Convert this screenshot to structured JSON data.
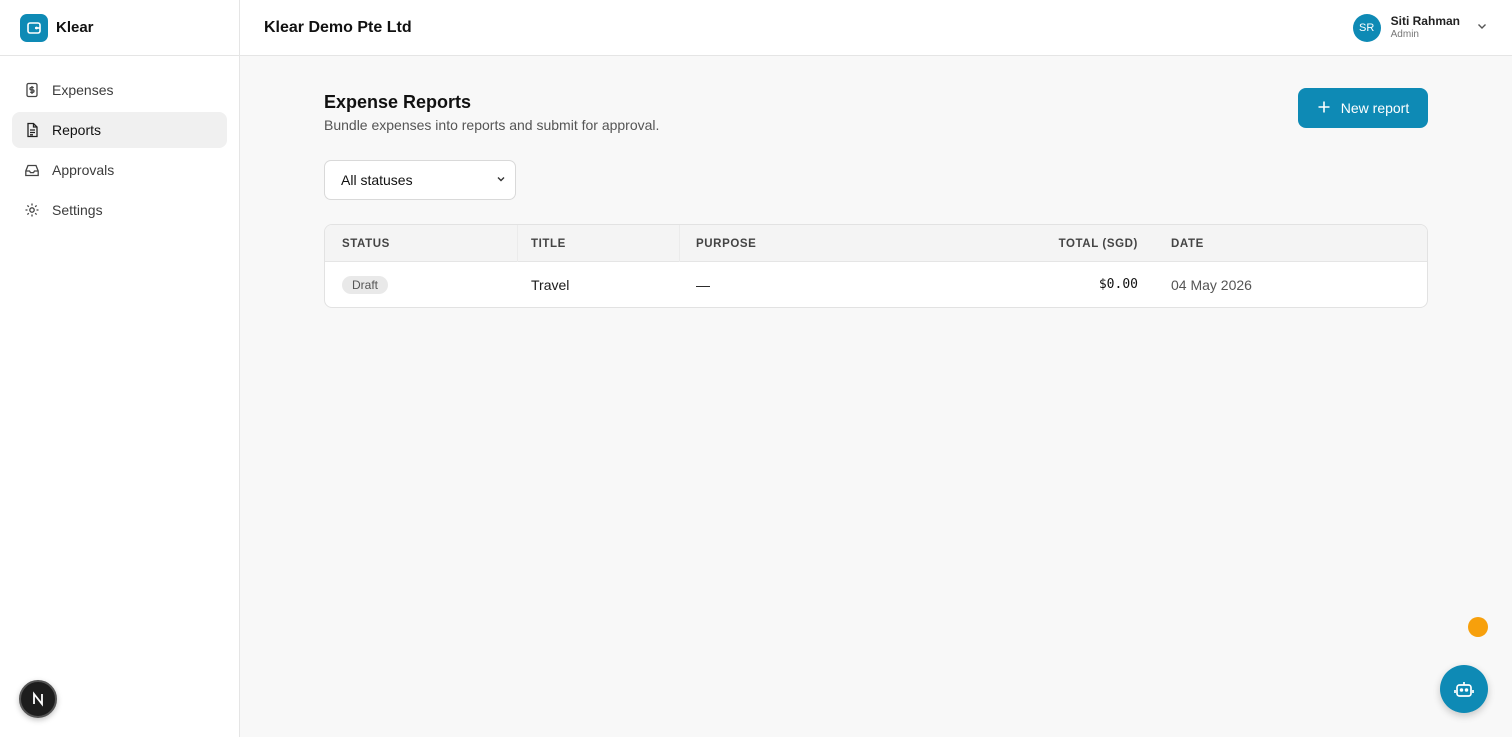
{
  "app": {
    "name": "Klear",
    "accent_color": "#0e8ab5"
  },
  "sidebar": {
    "items": [
      {
        "label": "Expenses",
        "icon": "receipt-icon",
        "active": false
      },
      {
        "label": "Reports",
        "icon": "document-icon",
        "active": true
      },
      {
        "label": "Approvals",
        "icon": "inbox-icon",
        "active": false
      },
      {
        "label": "Settings",
        "icon": "gear-icon",
        "active": false
      }
    ]
  },
  "header": {
    "company": "Klear Demo Pte Ltd",
    "user": {
      "initials": "SR",
      "name": "Siti Rahman",
      "role": "Admin"
    }
  },
  "main": {
    "title": "Expense Reports",
    "subtitle": "Bundle expenses into reports and submit for approval.",
    "new_button_label": "New report",
    "filter": {
      "selected": "All statuses"
    },
    "table": {
      "columns": [
        "STATUS",
        "TITLE",
        "PURPOSE",
        "TOTAL (SGD)",
        "DATE"
      ],
      "rows": [
        {
          "status": "Draft",
          "title": "Travel",
          "purpose": "—",
          "total": "$0.00",
          "date": "04 May 2026"
        }
      ]
    }
  },
  "floating": {
    "notification_color": "#f7a00c",
    "assistant_icon": "robot-icon",
    "dev_badge": "N"
  }
}
